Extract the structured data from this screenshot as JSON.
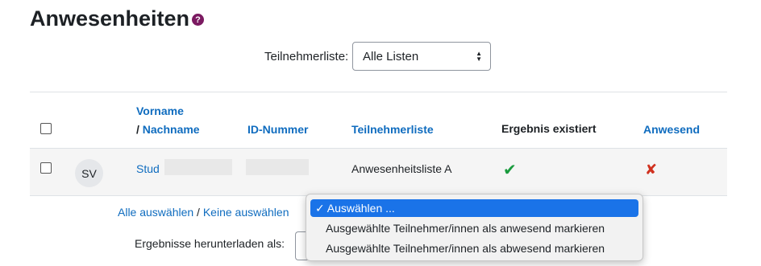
{
  "page": {
    "title": "Anwesenheiten",
    "help_icon": "?"
  },
  "filter": {
    "label": "Teilnehmerliste:",
    "value": "Alle Listen"
  },
  "table": {
    "headers": {
      "vorname": "Vorname",
      "nachname_prefix": "/ ",
      "nachname": "Nachname",
      "id": "ID-Nummer",
      "liste": "Teilnehmerliste",
      "ergebnis": "Ergebnis existiert",
      "anwesend": "Anwesend"
    },
    "rows": [
      {
        "initials": "SV",
        "name": "Stud",
        "liste": "Anwesenheitsliste A",
        "ergebnis_icon": "✔",
        "anwesend_icon": "✘"
      }
    ]
  },
  "selection": {
    "all": "Alle auswählen",
    "separator": " / ",
    "none": "Keine auswählen"
  },
  "download": {
    "label": "Ergebnisse herunterladen als:"
  },
  "action_menu": {
    "options": [
      {
        "label": "Auswählen ...",
        "selected": true
      },
      {
        "label": "Ausgewählte Teilnehmer/innen als anwesend markieren",
        "selected": false
      },
      {
        "label": "Ausgewählte Teilnehmer/innen als abwesend markieren",
        "selected": false
      }
    ],
    "check_glyph": "✓"
  },
  "colors": {
    "link": "#0f6cbf",
    "help": "#7b1a61",
    "check": "#1a9b3e",
    "cross": "#d0311f",
    "selected": "#1a73e8"
  }
}
